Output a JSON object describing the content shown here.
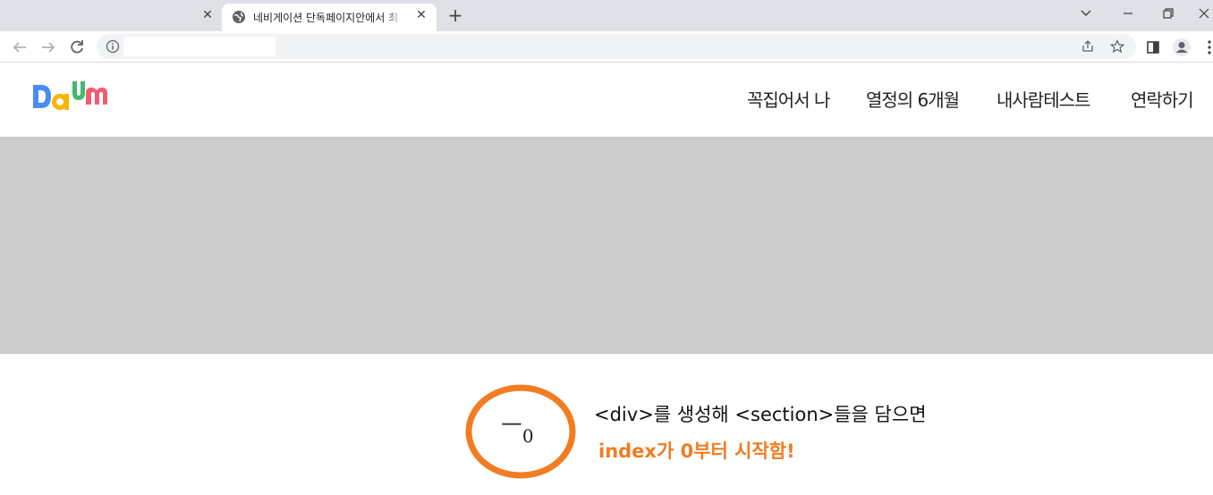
{
  "browser": {
    "tabs": [
      {
        "label": "",
        "active": false
      },
      {
        "label": "네비게이션 단독페이지안에서 최",
        "active": true
      }
    ],
    "address": ""
  },
  "site": {
    "logo_text": "Daum",
    "nav": [
      "꼭집어서 나",
      "열정의 6개월",
      "내사람테스트",
      "연락하기"
    ]
  },
  "annotation": {
    "mark": "ㅡ",
    "mark_sub": "0",
    "line1": "<div>를 생성해 <section>들을 담으면",
    "line2": "index가 0부터 시작함!",
    "accent_color": "#f27c22"
  },
  "colors": {
    "banner": "#cccccc",
    "tabstrip": "#dee1e6"
  }
}
